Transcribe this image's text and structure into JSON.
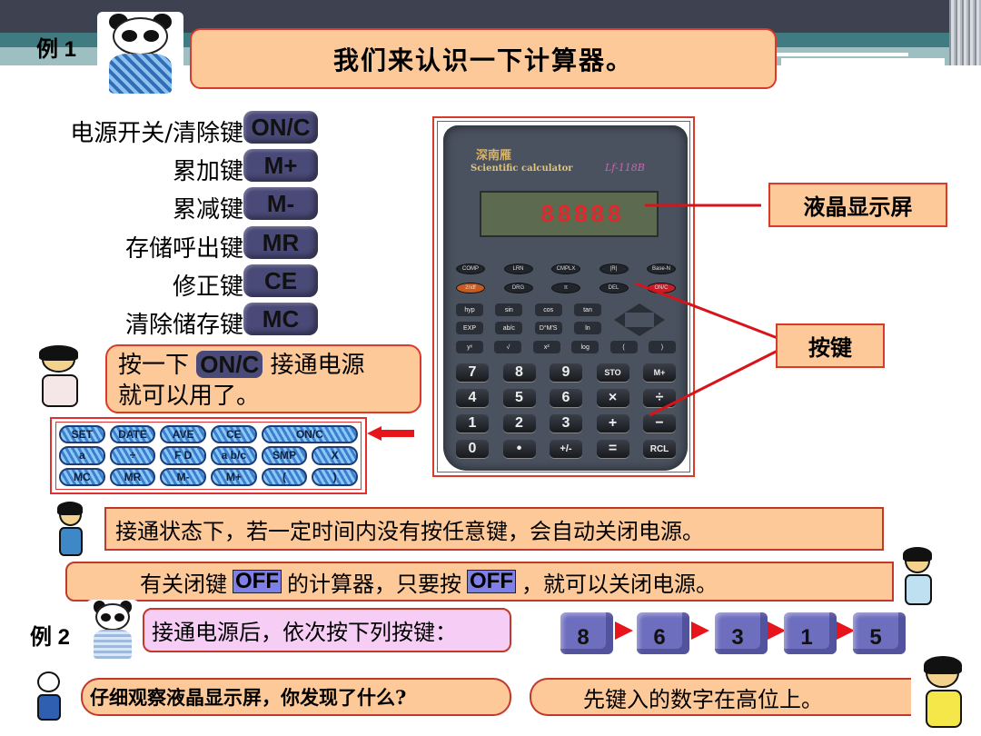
{
  "example1": {
    "label": "例 1",
    "title": "我们来认识一下计算器。"
  },
  "key_legend": [
    {
      "label": "电源开关/清除键",
      "key": "ON/C"
    },
    {
      "label": "累加键",
      "key": "M+"
    },
    {
      "label": "累减键",
      "key": "M-"
    },
    {
      "label": "存储呼出键",
      "key": "MR"
    },
    {
      "label": "修正键",
      "key": "CE"
    },
    {
      "label": "清除储存键",
      "key": "MC"
    }
  ],
  "speech1": {
    "part1": "按一下",
    "key": "ON/C",
    "part2": "接通电源",
    "line2": "就可以用了。"
  },
  "keypad_strip": {
    "rows": [
      [
        "SET",
        "DATE",
        "AVE",
        "CE",
        "ON/C"
      ],
      [
        "a",
        "÷",
        "F D",
        "a b/c",
        "SMP",
        "X"
      ],
      [
        "MC",
        "MR",
        "M-",
        "M+",
        "(",
        ")"
      ]
    ]
  },
  "calculator": {
    "brand_cn": "深南雁",
    "brand_en": "Scientific calculator",
    "model": "Lf-118B",
    "display": "88888",
    "fn_rows": [
      [
        "COMP",
        "LRN",
        "CMPLX",
        "|R|",
        "Base-N"
      ],
      [
        "2ndf",
        "DRG",
        "π",
        "DEL",
        "ON/C"
      ]
    ],
    "sci_rows": [
      [
        "hyp",
        "sin",
        "cos",
        "tan"
      ],
      [
        "EXP",
        "ab/c",
        "D°M′S",
        "ln"
      ],
      [
        "yˣ",
        "√",
        "x²",
        "log",
        "(",
        ")"
      ]
    ],
    "num_rows": [
      [
        "7",
        "8",
        "9",
        "STO",
        "M+"
      ],
      [
        "4",
        "5",
        "6",
        "×",
        "÷"
      ],
      [
        "1",
        "2",
        "3",
        "+",
        "−"
      ],
      [
        "0",
        "•",
        "+/-",
        "=",
        "RCL"
      ]
    ]
  },
  "callouts": {
    "display": "液晶显示屏",
    "keys": "按键"
  },
  "notes": {
    "auto_off": "接通状态下，若一定时间内没有按任意键，会自动关闭电源。",
    "off_part1": "有关闭键",
    "off_key": "OFF",
    "off_part2": "的计算器，只要按",
    "off_part3": "，就可以关闭电源。"
  },
  "example2": {
    "label": "例 2",
    "instruction": "接通电源后，依次按下列按键：",
    "sequence": [
      "8",
      "6",
      "3",
      "1",
      "5"
    ],
    "question": "仔细观察液晶显示屏，你发现了什么?",
    "answer": "先键入的数字在高位上。"
  },
  "colors": {
    "header_dark": "#3e4150",
    "header_teal": "#3f7b80",
    "box_fill": "#fdc999",
    "box_border": "#d83b2b",
    "key_fill": "#4a4a78",
    "digit_key_fill": "#6e6ebf",
    "pink_fill": "#f6cdf4",
    "arrow_red": "#e8141b"
  }
}
